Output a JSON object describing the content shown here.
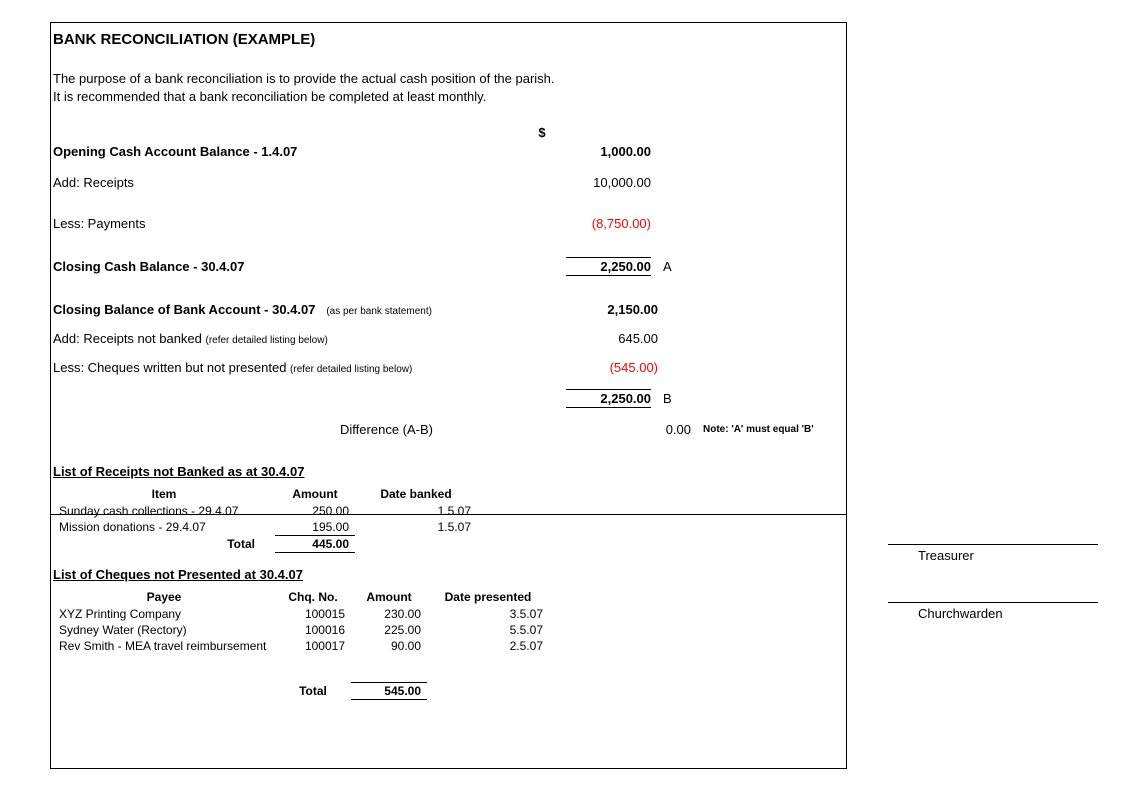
{
  "title": "BANK RECONCILIATION (EXAMPLE)",
  "intro1": "The purpose of a bank reconciliation is to provide the actual cash position of the parish.",
  "intro2": "It is recommended that a bank reconciliation be completed at least monthly.",
  "currency_header": "$",
  "section_a": {
    "opening": {
      "label": "Opening Cash Account Balance - 1.4.07",
      "amount": "1,000.00"
    },
    "add_receipts": {
      "label": "Add: Receipts",
      "amount": "10,000.00"
    },
    "less_payments": {
      "label": "Less: Payments",
      "amount": "(8,750.00)"
    },
    "closing_cash": {
      "label": "Closing Cash Balance - 30.4.07",
      "amount": "2,250.00",
      "letter": "A"
    }
  },
  "section_b": {
    "closing_bank": {
      "label": "Closing Balance of Bank Account  - 30.4.07",
      "note": "(as per bank statement)",
      "amount": "2,150.00"
    },
    "add_receipts_nb": {
      "label": "Add: Receipts not banked ",
      "note": "(refer detailed listing below)",
      "amount": "645.00"
    },
    "less_cheques_np": {
      "label": "Less: Cheques written but not presented ",
      "note": "(refer detailed listing below)",
      "amount": "(545.00)"
    },
    "subtotal": {
      "amount": "2,250.00",
      "letter": "B"
    },
    "difference": {
      "label": "Difference (A-B)",
      "amount": "0.00",
      "remark": "Note: 'A' must equal 'B'"
    }
  },
  "receipts_list": {
    "heading": "List of Receipts not Banked as at 30.4.07",
    "headers": {
      "item": "Item",
      "amount": "Amount",
      "date_banked": "Date banked"
    },
    "rows": [
      {
        "item": "Sunday cash collections - 29.4.07",
        "amount": "250.00",
        "date_banked": "1.5.07"
      },
      {
        "item": "Mission donations - 29.4.07",
        "amount": "195.00",
        "date_banked": "1.5.07"
      }
    ],
    "total_label": "Total",
    "total": "445.00"
  },
  "cheques_list": {
    "heading": "List of Cheques not Presented at 30.4.07",
    "headers": {
      "payee": "Payee",
      "chq_no": "Chq. No.",
      "amount": "Amount",
      "date_presented": "Date presented"
    },
    "rows": [
      {
        "payee": "XYZ Printing Company",
        "chq_no": "100015",
        "amount": "230.00",
        "date_presented": "3.5.07"
      },
      {
        "payee": "Sydney Water (Rectory)",
        "chq_no": "100016",
        "amount": "225.00",
        "date_presented": "5.5.07"
      },
      {
        "payee": "Rev Smith - MEA travel reimbursement",
        "chq_no": "100017",
        "amount": "90.00",
        "date_presented": "2.5.07"
      }
    ],
    "total_label": "Total",
    "total": "545.00"
  },
  "signatures": {
    "treasurer": "Treasurer",
    "churchwarden": "Churchwarden"
  }
}
